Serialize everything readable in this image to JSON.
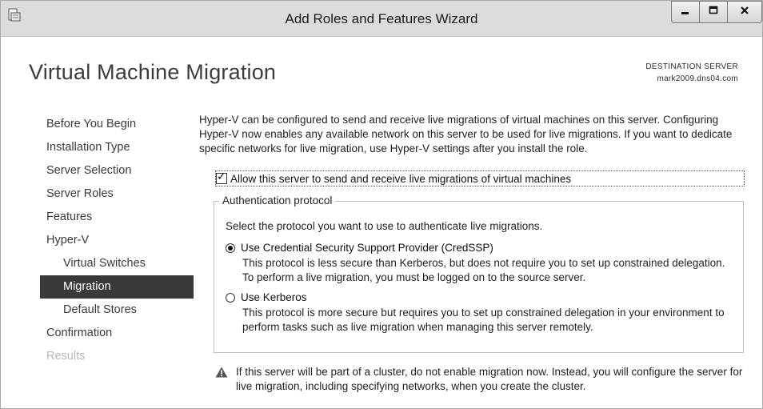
{
  "window": {
    "title": "Add Roles and Features Wizard",
    "controls": {
      "minimize_icon": "minimize-icon",
      "maximize_icon": "maximize-icon",
      "close_icon": "close-icon"
    }
  },
  "header": {
    "page_title": "Virtual Machine Migration",
    "destination_label": "DESTINATION SERVER",
    "destination_server": "mark2009.dns04.com"
  },
  "nav": {
    "items": [
      {
        "label": "Before You Begin",
        "state": "normal"
      },
      {
        "label": "Installation Type",
        "state": "normal"
      },
      {
        "label": "Server Selection",
        "state": "normal"
      },
      {
        "label": "Server Roles",
        "state": "normal"
      },
      {
        "label": "Features",
        "state": "normal"
      },
      {
        "label": "Hyper-V",
        "state": "normal"
      },
      {
        "label": "Virtual Switches",
        "state": "sub"
      },
      {
        "label": "Migration",
        "state": "active"
      },
      {
        "label": "Default Stores",
        "state": "sub"
      },
      {
        "label": "Confirmation",
        "state": "normal"
      },
      {
        "label": "Results",
        "state": "disabled"
      }
    ]
  },
  "main": {
    "description": "Hyper-V can be configured to send and receive live migrations of virtual machines on this server. Configuring Hyper-V now enables any available network on this server to be used for live migrations. If you want to dedicate specific networks for live migration, use Hyper-V settings after you install the role.",
    "allow_checkbox": {
      "label": "Allow this server to send and receive live migrations of virtual machines",
      "checked": true
    },
    "auth_group": {
      "legend": "Authentication protocol",
      "hint": "Select the protocol you want to use to authenticate live migrations.",
      "options": [
        {
          "label": "Use Credential Security Support Provider (CredSSP)",
          "description": "This protocol is less secure than Kerberos, but does not require you to set up constrained delegation. To perform a live migration, you must be logged on to the source server.",
          "selected": true
        },
        {
          "label": "Use Kerberos",
          "description": "This protocol is more secure but requires you to set up constrained delegation in your environment to perform tasks such as live migration when managing this server remotely.",
          "selected": false
        }
      ]
    },
    "warning": {
      "icon": "warning-icon",
      "text": "If this server will be part of a cluster, do not enable migration now. Instead, you will configure the server for live migration, including specifying networks, when you create the cluster."
    }
  }
}
